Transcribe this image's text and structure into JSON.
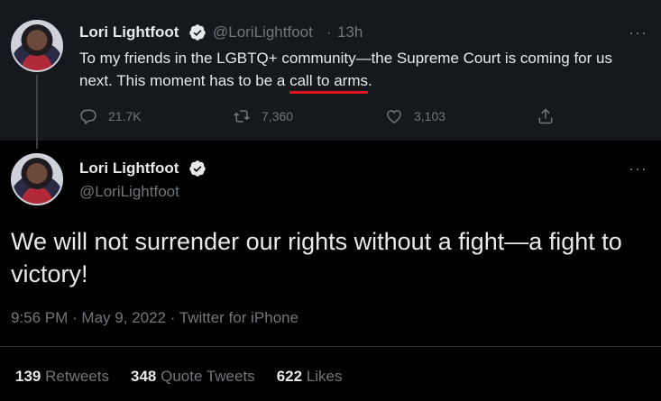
{
  "first_tweet": {
    "name": "Lori Lightfoot",
    "handle": "@LoriLightfoot",
    "separator": "·",
    "time": "13h",
    "text_before": "To my friends in the LGBTQ+ community—the Supreme Court is coming for us next. This moment has to be a ",
    "text_highlight": "call to arms",
    "text_after": ".",
    "more": "···",
    "replies": "21.7K",
    "retweets": "7,360",
    "likes": "3,103"
  },
  "main_tweet": {
    "name": "Lori Lightfoot",
    "handle": "@LoriLightfoot",
    "more": "···",
    "text": "We will not surrender our rights without a fight—a fight to victory!",
    "meta": "9:56 PM · May 9, 2022 · Twitter for iPhone"
  },
  "stats": {
    "retweets_count": "139",
    "retweets_label": "Retweets",
    "quotes_count": "348",
    "quotes_label": "Quote Tweets",
    "likes_count": "622",
    "likes_label": "Likes"
  },
  "colors": {
    "background": "#000000",
    "first_tweet_bg": "#15181c",
    "text": "#e7e9ea",
    "secondary": "#71767b",
    "underline": "#e0141e"
  }
}
